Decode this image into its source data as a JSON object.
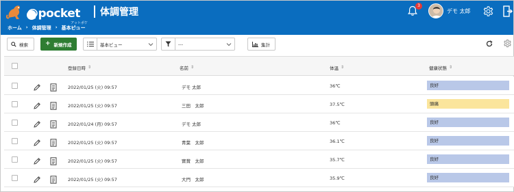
{
  "header": {
    "logo_text": "@pocket",
    "logo_sub": "アットポケット",
    "title": "体調管理",
    "breadcrumb": [
      "ホーム",
      "›",
      "体調管理",
      "›",
      "基本ビュー"
    ],
    "notification_count": "3",
    "user_name": "デモ 太郎"
  },
  "toolbar": {
    "search_label": "検索",
    "new_label": "新規作成",
    "view_selected": "基本ビュー",
    "filter_selected": "---",
    "aggregate_label": "集計"
  },
  "table": {
    "columns": [
      "登録日時",
      "名前",
      "体温",
      "健康状態"
    ],
    "rows": [
      {
        "date": "2022/01/25 (火) 09:57",
        "name": "デモ 太郎",
        "temp": "36℃",
        "status": "良好"
      },
      {
        "date": "2022/01/25 (火) 09:57",
        "name": "三田　太郎",
        "temp": "37.5℃",
        "status": "頭痛"
      },
      {
        "date": "2022/01/24 (月) 09:57",
        "name": "デモ 太郎",
        "temp": "36℃",
        "status": "良好"
      },
      {
        "date": "2022/01/25 (火) 09:57",
        "name": "青葉　太郎",
        "temp": "36.1℃",
        "status": "良好"
      },
      {
        "date": "2022/01/25 (火) 09:57",
        "name": "實賞　太郎",
        "temp": "35.7℃",
        "status": "良好"
      },
      {
        "date": "2022/01/25 (火) 09:57",
        "name": "大門　太郎",
        "temp": "35.9℃",
        "status": "良好"
      }
    ]
  },
  "colors": {
    "header_bg": "#0a6dbf",
    "new_button": "#2e7d32",
    "status_good": "#b9c8e8",
    "status_bad": "#fbe59c"
  }
}
